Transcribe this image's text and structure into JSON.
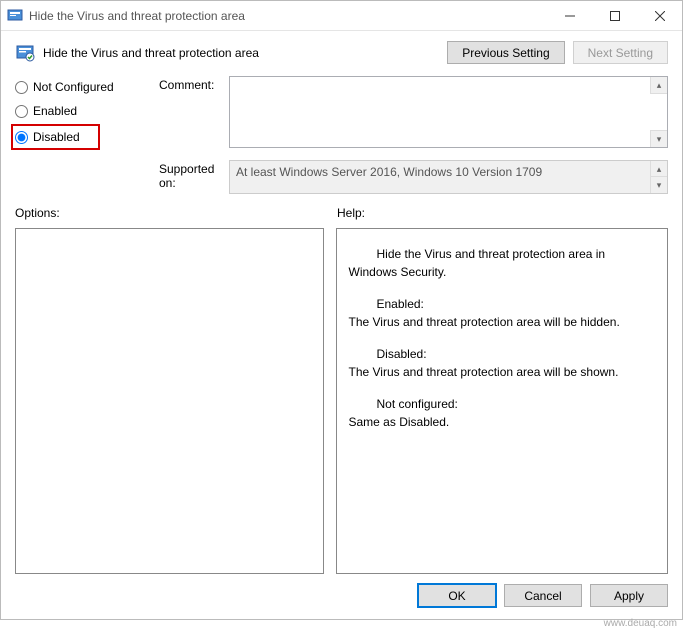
{
  "window": {
    "title": "Hide the Virus and threat protection area"
  },
  "header": {
    "title": "Hide the Virus and threat protection area",
    "prev_btn": "Previous Setting",
    "next_btn": "Next Setting"
  },
  "radios": {
    "not_configured": "Not Configured",
    "enabled": "Enabled",
    "disabled": "Disabled",
    "selected": "disabled"
  },
  "comment": {
    "label": "Comment:",
    "value": ""
  },
  "supported": {
    "label": "Supported on:",
    "value": "At least Windows Server 2016, Windows 10 Version 1709"
  },
  "panes": {
    "options_label": "Options:",
    "help_label": "Help:"
  },
  "help": {
    "p1": "Hide the Virus and threat protection area in Windows Security.",
    "p2a": "Enabled:",
    "p2b": "The Virus and threat protection area will be hidden.",
    "p3a": "Disabled:",
    "p3b": "The Virus and threat protection area will be shown.",
    "p4a": "Not configured:",
    "p4b": "Same as Disabled."
  },
  "footer": {
    "ok": "OK",
    "cancel": "Cancel",
    "apply": "Apply"
  },
  "watermark": "www.deuaq.com"
}
